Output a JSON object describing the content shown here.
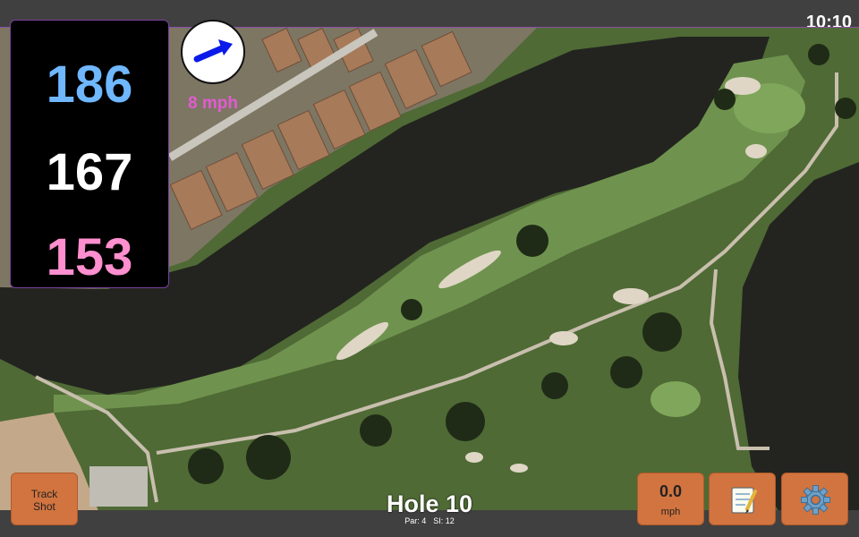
{
  "status_bar": {
    "time": "10:10"
  },
  "distances": {
    "back": "186",
    "middle": "167",
    "front": "153",
    "back_color": "#6fb7ff",
    "middle_color": "#ffffff",
    "front_color": "#ff8fcf"
  },
  "wind": {
    "speed": "8 mph",
    "direction_icon": "arrow-icon",
    "color": "#e25bd2"
  },
  "hole": {
    "title": "Hole 10",
    "par": "Par: 4",
    "stroke_index": "SI: 12"
  },
  "buttons": {
    "track_shot": "Track\nShot",
    "speed_value": "0.0",
    "speed_unit": "mph",
    "notes_icon": "notepad-icon",
    "settings_icon": "gear-icon"
  },
  "colors": {
    "button_bg": "#d2743f",
    "panel_border": "#7b3fa0"
  }
}
